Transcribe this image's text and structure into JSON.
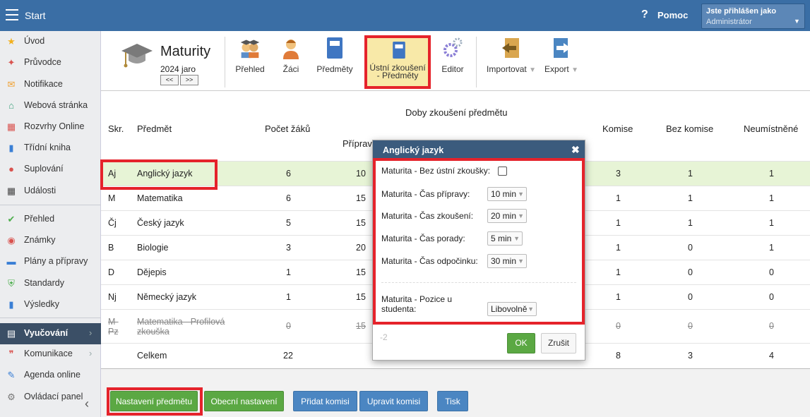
{
  "topbar": {
    "start": "Start",
    "help_q": "?",
    "help": "Pomoc",
    "login_title": "Jste přihlášen jako",
    "login_user": "Administrátor"
  },
  "sidebar": {
    "items": [
      {
        "label": "Úvod",
        "icon": "star-icon"
      },
      {
        "label": "Průvodce",
        "icon": "wand-icon"
      },
      {
        "label": "Notifikace",
        "icon": "envelope-icon"
      },
      {
        "label": "Webová stránka",
        "icon": "home-icon"
      },
      {
        "label": "Rozvrhy Online",
        "icon": "calendar-icon"
      },
      {
        "label": "Třídní kniha",
        "icon": "book-icon"
      },
      {
        "label": "Suplování",
        "icon": "person-icon"
      },
      {
        "label": "Události",
        "icon": "calendar-event-icon"
      },
      {
        "label": "Přehled",
        "icon": "check-circle-icon"
      },
      {
        "label": "Známky",
        "icon": "grade-icon"
      },
      {
        "label": "Plány a přípravy",
        "icon": "briefcase-icon"
      },
      {
        "label": "Standardy",
        "icon": "shield-icon"
      },
      {
        "label": "Výsledky",
        "icon": "bar-chart-icon"
      },
      {
        "label": "Vyučování",
        "icon": "open-book-icon"
      },
      {
        "label": "Komunikace",
        "icon": "chat-icon"
      },
      {
        "label": "Agenda online",
        "icon": "pen-icon"
      },
      {
        "label": "Ovládací panel",
        "icon": "gear-icon"
      }
    ]
  },
  "module": {
    "title": "Maturity",
    "year": "2024 jaro",
    "prev": "<<",
    "next": ">>"
  },
  "toolbar": {
    "prehled": "Přehled",
    "zaci": "Žáci",
    "predmety": "Předměty",
    "ustni_1": "Ústní zkoušení",
    "ustni_2": "- Předměty",
    "editor": "Editor",
    "import": "Importovat",
    "export": "Export"
  },
  "table": {
    "h_skr": "Skr.",
    "h_predmet": "Předmět",
    "h_pocet": "Počet žáků",
    "h_doby": "Doby zkoušení předmětu",
    "h_priprava": "Příprava",
    "h_komise": "Komise",
    "h_bez": "Bez komise",
    "h_neum": "Neumístněné",
    "rows": [
      {
        "skr": "Aj",
        "predmet": "Anglický jazyk",
        "pocet": "6",
        "priprava": "10",
        "komise": "3",
        "bez": "1",
        "neum": "1"
      },
      {
        "skr": "M",
        "predmet": "Matematika",
        "pocet": "6",
        "priprava": "15",
        "komise": "1",
        "bez": "1",
        "neum": "1"
      },
      {
        "skr": "Čj",
        "predmet": "Český jazyk",
        "pocet": "5",
        "priprava": "15",
        "komise": "1",
        "bez": "1",
        "neum": "1"
      },
      {
        "skr": "B",
        "predmet": "Biologie",
        "pocet": "3",
        "priprava": "20",
        "komise": "1",
        "bez": "0",
        "neum": "1"
      },
      {
        "skr": "D",
        "predmet": "Dějepis",
        "pocet": "1",
        "priprava": "15",
        "komise": "1",
        "bez": "0",
        "neum": "0"
      },
      {
        "skr": "Nj",
        "predmet": "Německý jazyk",
        "pocet": "1",
        "priprava": "15",
        "komise": "1",
        "bez": "0",
        "neum": "0"
      },
      {
        "skr": "M-Pz",
        "predmet": "Matematika - Profilová zkouška",
        "pocet": "0",
        "priprava": "15",
        "komise": "0",
        "bez": "0",
        "neum": "0"
      }
    ],
    "total": {
      "label": "Celkem",
      "pocet": "22",
      "komise": "8",
      "bez": "3",
      "neum": "4"
    }
  },
  "buttons": {
    "nastaveni": "Nastavení předmětu",
    "obecni": "Obecní nastavení",
    "pridat": "Přidat komisi",
    "upravit": "Upravit komisi",
    "tisk": "Tisk"
  },
  "dialog": {
    "title": "Anglický jazyk",
    "close": "✖",
    "bez_ustni": "Maturita - Bez ústní zkoušky:",
    "cas_pripravy": "Maturita - Čas přípravy:",
    "cas_pripravy_val": "10 min",
    "cas_zkouseni": "Maturita - Čas zkoušení:",
    "cas_zkouseni_val": "20 min",
    "cas_porady": "Maturita - Čas porady:",
    "cas_porady_val": "5 min",
    "cas_odpocinku": "Maturita - Čas odpočinku:",
    "cas_odpocinku_val": "30 min",
    "pozice_1": "Maturita - Pozice u",
    "pozice_2": "studenta:",
    "pozice_val": "Libovolně",
    "num": "-2",
    "ok": "OK",
    "cancel": "Zrušit"
  }
}
